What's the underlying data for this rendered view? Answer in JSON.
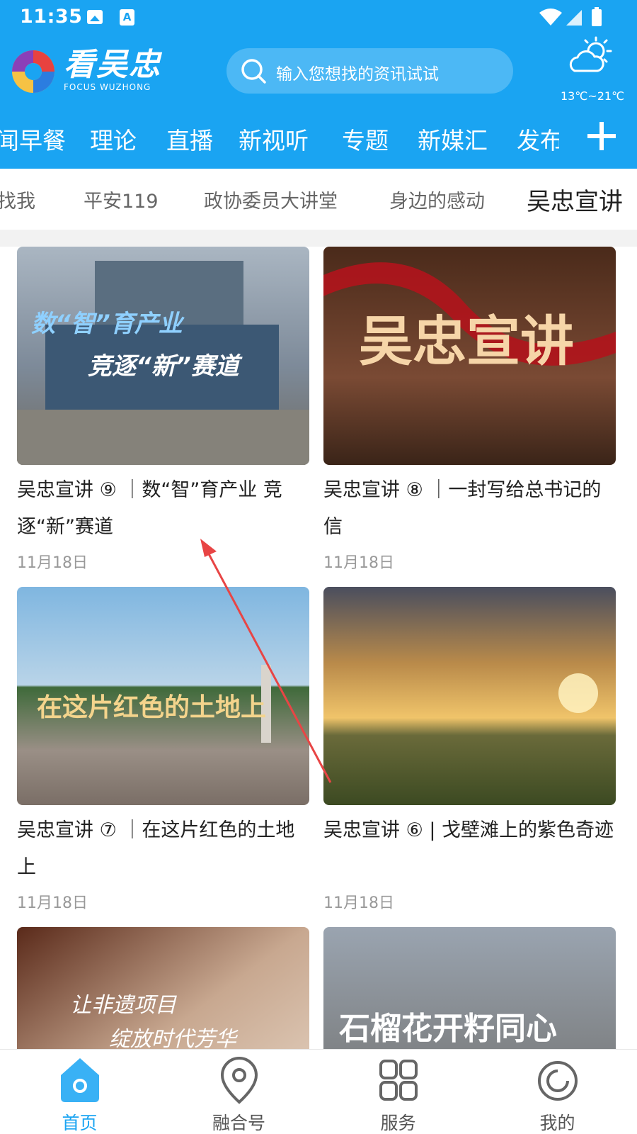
{
  "status_bar": {
    "time": "11:35",
    "icons": [
      "image-icon",
      "a-icon",
      "wifi-icon",
      "signal-icon",
      "battery-icon"
    ]
  },
  "header": {
    "logo_text": "看吴忠",
    "logo_sub": "FOCUS WUZHONG",
    "search_placeholder": "输入您想找的资讯试试",
    "weather_temp": "13℃~21℃"
  },
  "channels": [
    "闻早餐",
    "理论",
    "直播",
    "新视听",
    "专题",
    "新媒汇",
    "发布"
  ],
  "subnav": [
    "找我",
    "平安119",
    "政协委员大讲堂",
    "身边的感动",
    "吴忠宣讲"
  ],
  "cards": [
    {
      "title": "吴忠宣讲 ⑨ ｜数“智”育产业 竞逐“新”赛道",
      "date": "11月18日",
      "overlay1": "数“智”育产业",
      "overlay2": "竞逐“新”赛道"
    },
    {
      "title": "吴忠宣讲 ⑧ ｜一封写给总书记的信",
      "date": "11月18日",
      "overlay1": "吴忠宣讲"
    },
    {
      "title": "吴忠宣讲 ⑦ ｜在这片红色的土地上",
      "date": "11月18日",
      "overlay1": "在这片红色的土地上"
    },
    {
      "title": "吴忠宣讲 ⑥ | 戈壁滩上的紫色奇迹",
      "date": "11月18日"
    },
    {
      "overlay1": "让非遗项目",
      "overlay2": "绽放时代芳华"
    },
    {
      "overlay1": "石榴花开籽同心"
    }
  ],
  "tabbar": [
    {
      "label": "首页",
      "icon": "home-icon",
      "active": true
    },
    {
      "label": "融合号",
      "icon": "location-pin-icon"
    },
    {
      "label": "服务",
      "icon": "grid-icon"
    },
    {
      "label": "我的",
      "icon": "profile-icon"
    }
  ],
  "colors": {
    "brand_blue": "#1aa4f2",
    "annotation_arrow": "#e84545"
  }
}
